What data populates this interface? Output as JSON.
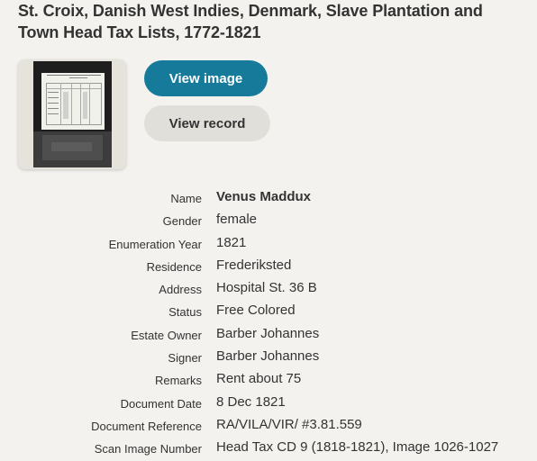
{
  "collection": {
    "title_line1": "St. Croix, Danish West Indies, Denmark, Slave Plantation and",
    "title_line2": "Town Head Tax Lists, 1772-1821"
  },
  "actions": {
    "view_image": "View image",
    "view_record": "View record"
  },
  "record": {
    "fields": [
      {
        "label": "Name",
        "value": "Venus Maddux"
      },
      {
        "label": "Gender",
        "value": "female"
      },
      {
        "label": "Enumeration Year",
        "value": "1821"
      },
      {
        "label": "Residence",
        "value": "Frederiksted"
      },
      {
        "label": "Address",
        "value": "Hospital St. 36 B"
      },
      {
        "label": "Status",
        "value": "Free Colored"
      },
      {
        "label": "Estate Owner",
        "value": "Barber Johannes"
      },
      {
        "label": "Signer",
        "value": "Barber Johannes"
      },
      {
        "label": "Remarks",
        "value": "Rent about 75"
      },
      {
        "label": "Document Date",
        "value": "8 Dec 1821"
      },
      {
        "label": "Document Reference",
        "value": "RA/VILA/VIR/ #3.81.559"
      },
      {
        "label": "Scan Image Number",
        "value": "Head Tax CD 9 (1818-1821), Image 1026-1027"
      }
    ]
  },
  "colors": {
    "background": "#f4f2ee",
    "primary_button": "#167a9b",
    "secondary_button": "#e1dfda"
  }
}
